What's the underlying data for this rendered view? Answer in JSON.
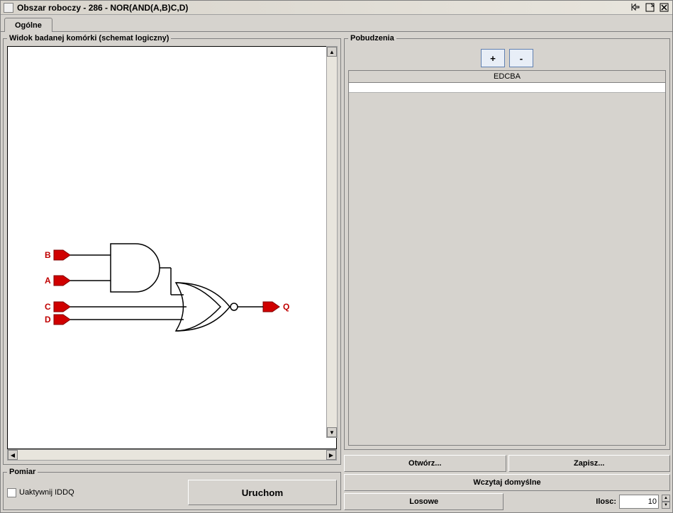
{
  "window": {
    "title": "Obszar roboczy - 286 - NOR(AND(A,B)C,D)"
  },
  "tabs": {
    "general": "Ogólne"
  },
  "left": {
    "schematic_legend": "Widok badanej komórki (schemat logiczny)",
    "pins": {
      "B": "B",
      "A": "A",
      "C": "C",
      "D": "D",
      "Q": "Q"
    }
  },
  "pomiar": {
    "legend": "Pomiar",
    "iddq_label": "Uaktywnij IDDQ",
    "run": "Uruchom"
  },
  "pob": {
    "legend": "Pobudzenia",
    "plus": "+",
    "minus": "-",
    "header": "EDCBA"
  },
  "buttons": {
    "open": "Otwórz...",
    "save": "Zapisz...",
    "load_default": "Wczytaj domyślne",
    "random": "Losowe",
    "count_label": "Ilosc:",
    "count_value": "10"
  }
}
